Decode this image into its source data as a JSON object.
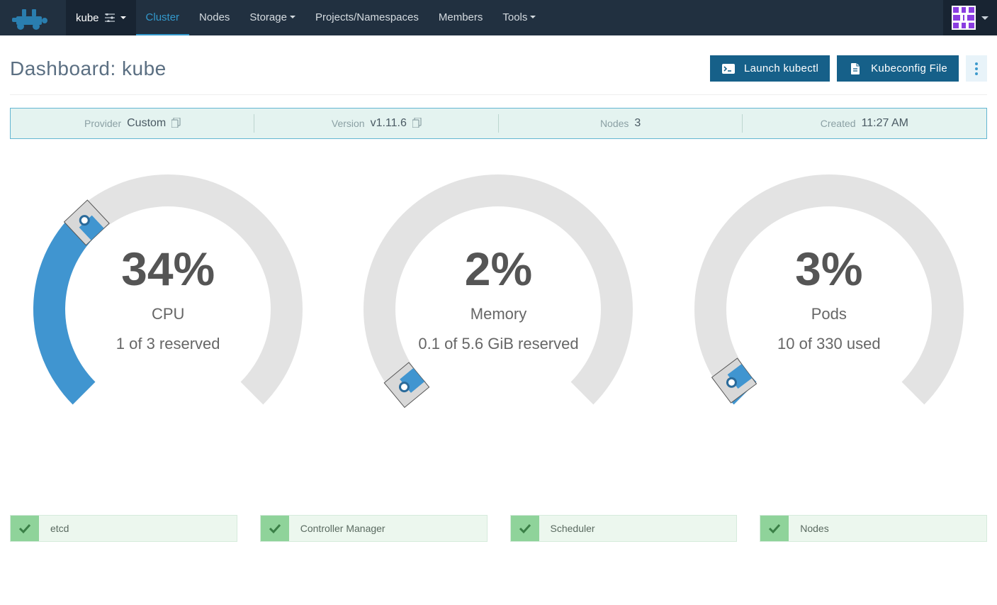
{
  "nav": {
    "cluster_name": "kube",
    "tabs": [
      "Cluster",
      "Nodes",
      "Storage",
      "Projects/Namespaces",
      "Members",
      "Tools"
    ],
    "active_tab": "Cluster"
  },
  "header": {
    "title": "Dashboard: kube",
    "launch_kubectl": "Launch kubectl",
    "kubeconfig_file": "Kubeconfig File"
  },
  "info": {
    "provider_label": "Provider",
    "provider_value": "Custom",
    "version_label": "Version",
    "version_value": "v1.11.6",
    "nodes_label": "Nodes",
    "nodes_value": "3",
    "created_label": "Created",
    "created_value": "11:27 AM"
  },
  "gauges": {
    "cpu": {
      "percent": "34%",
      "title": "CPU",
      "sub": "1 of 3 reserved",
      "fraction": 0.34
    },
    "memory": {
      "percent": "2%",
      "title": "Memory",
      "sub": "0.1 of 5.6 GiB reserved",
      "fraction": 0.02
    },
    "pods": {
      "percent": "3%",
      "title": "Pods",
      "sub": "10 of 330 used",
      "fraction": 0.03
    }
  },
  "status": {
    "etcd": "etcd",
    "controller": "Controller Manager",
    "scheduler": "Scheduler",
    "nodes": "Nodes"
  },
  "chart_data": [
    {
      "type": "gauge",
      "title": "CPU",
      "value": 34,
      "max": 100,
      "unit": "%",
      "detail": "1 of 3 reserved"
    },
    {
      "type": "gauge",
      "title": "Memory",
      "value": 2,
      "max": 100,
      "unit": "%",
      "detail": "0.1 of 5.6 GiB reserved"
    },
    {
      "type": "gauge",
      "title": "Pods",
      "value": 3,
      "max": 100,
      "unit": "%",
      "detail": "10 of 330 used"
    }
  ]
}
